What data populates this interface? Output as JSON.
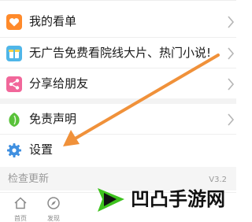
{
  "menu": {
    "items": [
      {
        "label": "我的看单",
        "icon": "heart-icon",
        "color": "#ff8a2b"
      },
      {
        "label": "无广告免费看院线大片、热门小说!",
        "icon": "gift-box-icon",
        "color": "#4fb6e8"
      },
      {
        "label": "分享给朋友",
        "icon": "share-icon",
        "color": "#f1679a"
      },
      {
        "label": "免责声明",
        "icon": "leaf-shield-icon",
        "color": "#59c23a"
      },
      {
        "label": "设置",
        "icon": "gear-icon",
        "color": "#3f8fe0"
      }
    ]
  },
  "update": {
    "label": "检查更新",
    "version": "V3.2"
  },
  "tabbar": {
    "tabs": [
      {
        "label": "首页",
        "icon": "home-icon"
      },
      {
        "label": "发现",
        "icon": "compass-icon"
      }
    ]
  },
  "watermark": {
    "text": "凹凸手游网"
  },
  "annotation": {
    "arrow_color": "#f0913a"
  }
}
